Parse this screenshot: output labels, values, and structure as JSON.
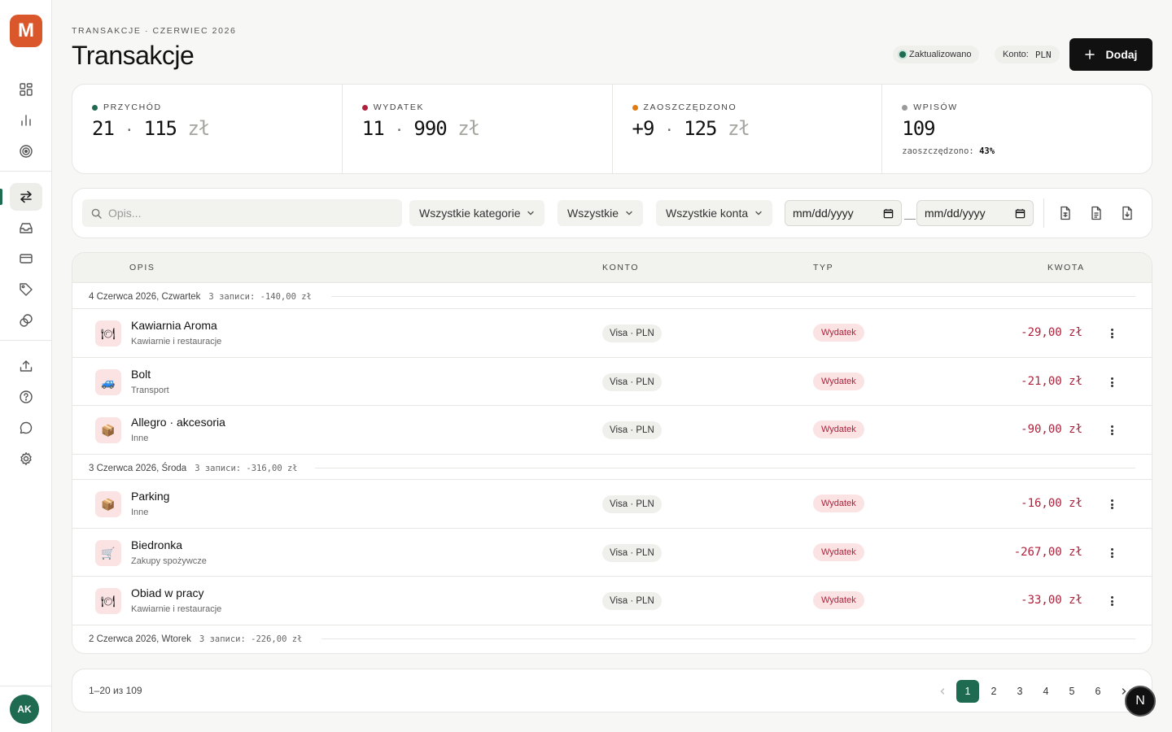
{
  "brand": {
    "logo_letter": "M",
    "accent": "#1e6b52",
    "logo_color": "#d9572a"
  },
  "sidebar": {
    "items": [
      {
        "icon": "dashboard-icon"
      },
      {
        "icon": "bar-chart-icon"
      },
      {
        "icon": "target-icon"
      },
      {
        "icon": "transfer-arrows-icon",
        "active": true
      },
      {
        "icon": "inbox-icon"
      },
      {
        "icon": "credit-card-icon"
      },
      {
        "icon": "tag-icon"
      },
      {
        "icon": "coins-icon"
      },
      {
        "icon": "upload-icon"
      },
      {
        "icon": "help-icon"
      },
      {
        "icon": "chat-icon"
      },
      {
        "icon": "gear-icon"
      }
    ],
    "avatar_initials": "AK"
  },
  "header": {
    "eyebrow": "TRANSAKCJE · CZERWIEC 2026",
    "title": "Transakcje",
    "status_label": "Zaktualizowano",
    "konto_label": "Konto:",
    "konto_value": "PLN",
    "add_button_label": "Dodaj"
  },
  "stats": [
    {
      "label": "PRZYCHÓD",
      "value": "21",
      "value2": "115",
      "unit": "zł",
      "dot_color": "#1e6b52"
    },
    {
      "label": "WYDATEK",
      "value": "11",
      "value2": "990",
      "unit": "zł",
      "dot_color": "#b0203b"
    },
    {
      "label": "ZAOSZCZĘDZONO",
      "value": "+9",
      "value2": "125",
      "unit": "zł",
      "dot_color": "#e07b12"
    },
    {
      "label": "WPISÓW",
      "value": "109",
      "note_label": "zaoszczędzono:",
      "note_value": "43%",
      "dot_color": "#9a9a9a"
    }
  ],
  "filters": {
    "search_placeholder": "Opis...",
    "category_select": "Wszystkie kategorie",
    "type_select": "Wszystkie",
    "account_select": "Wszystkie konta",
    "date_from": "mm/dd/yyyy",
    "date_to": "mm/dd/yyyy",
    "date_separator": "—"
  },
  "table": {
    "columns": [
      "OPIS",
      "KONTO",
      "TYP",
      "KWOTA"
    ],
    "groups": [
      {
        "date": "4 Czerwca 2026, Czwartek",
        "meta": "3 записи: -140,00 zł"
      },
      {
        "date": "3 Czerwca 2026, Środa",
        "meta": "3 записи: -316,00 zł"
      },
      {
        "date": "2 Czerwca 2026, Wtorek",
        "meta": "3 записи: -226,00 zł"
      }
    ],
    "rows": [
      {
        "title": "Kawiarnia Aroma",
        "category": "Kawiarnie i restauracje",
        "icon": "🍽",
        "account": "Visa · PLN",
        "type": "Wydatek",
        "amount": "-29,00 zł"
      },
      {
        "title": "Bolt",
        "category": "Transport",
        "icon": "🚙",
        "account": "Visa · PLN",
        "type": "Wydatek",
        "amount": "-21,00 zł"
      },
      {
        "title": "Allegro · akcesoria",
        "category": "Inne",
        "icon": "📦",
        "account": "Visa · PLN",
        "type": "Wydatek",
        "amount": "-90,00 zł"
      },
      {
        "title": "Parking",
        "category": "Inne",
        "icon": "📦",
        "account": "Visa · PLN",
        "type": "Wydatek",
        "amount": "-16,00 zł"
      },
      {
        "title": "Biedronka",
        "category": "Zakupy spożywcze",
        "icon": "🛒",
        "account": "Visa · PLN",
        "type": "Wydatek",
        "amount": "-267,00 zł"
      },
      {
        "title": "Obiad w pracy",
        "category": "Kawiarnie i restauracje",
        "icon": "🍽",
        "account": "Visa · PLN",
        "type": "Wydatek",
        "amount": "-33,00 zł"
      }
    ]
  },
  "pagination": {
    "info": "1–20 из 109",
    "pages": [
      "1",
      "2",
      "3",
      "4",
      "5",
      "6"
    ],
    "current": "1"
  },
  "fab_label": "N"
}
